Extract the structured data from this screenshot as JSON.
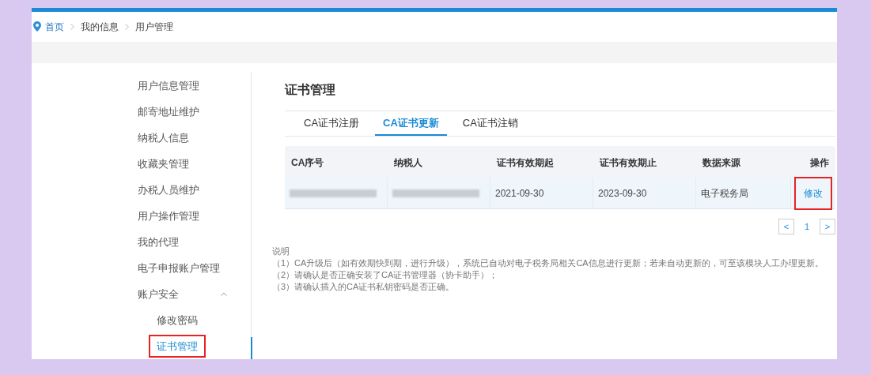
{
  "breadcrumb": [
    {
      "label": "首页",
      "kind": "home"
    },
    {
      "label": "我的信息",
      "kind": "plain"
    },
    {
      "label": "用户管理",
      "kind": "plain"
    }
  ],
  "sidebar": {
    "items": [
      {
        "label": "用户信息管理",
        "selected": false,
        "highlighted": false
      },
      {
        "label": "邮寄地址维护",
        "selected": false,
        "highlighted": false
      },
      {
        "label": "纳税人信息",
        "selected": false,
        "highlighted": false
      },
      {
        "label": "收藏夹管理",
        "selected": false,
        "highlighted": false
      },
      {
        "label": "办税人员维护",
        "selected": false,
        "highlighted": false
      },
      {
        "label": "用户操作管理",
        "selected": false,
        "highlighted": false
      },
      {
        "label": "我的代理",
        "selected": false,
        "highlighted": false
      },
      {
        "label": "电子申报账户管理",
        "selected": false,
        "highlighted": false
      },
      {
        "label": "账户安全",
        "selected": false,
        "highlighted": false,
        "expanded": true,
        "children": [
          {
            "label": "修改密码",
            "selected": false,
            "highlighted": false
          },
          {
            "label": "证书管理",
            "selected": true,
            "highlighted": true
          }
        ]
      }
    ]
  },
  "title": "证书管理",
  "tabs": [
    {
      "label": "CA证书注册",
      "selected": false
    },
    {
      "label": "CA证书更新",
      "selected": true
    },
    {
      "label": "CA证书注销",
      "selected": false
    }
  ],
  "table": {
    "columns": [
      "CA序号",
      "纳税人",
      "证书有效期起",
      "证书有效期止",
      "数据来源",
      "操作"
    ],
    "rows": [
      {
        "cells": [
          {
            "kind": "redacted"
          },
          {
            "kind": "redacted"
          },
          {
            "kind": "text",
            "text": "2021-09-30"
          },
          {
            "kind": "text",
            "text": "2023-09-30"
          },
          {
            "kind": "text",
            "text": "电子税务局"
          },
          {
            "kind": "link",
            "text": "修改",
            "highlighted": true
          }
        ]
      }
    ]
  },
  "pagination": {
    "prev": "<",
    "pages": [
      {
        "label": "1",
        "selected": true
      }
    ],
    "next": ">"
  },
  "notes": {
    "heading": "说明",
    "lines": [
      "（1）CA升级后（如有效期快到期，进行升级），系统已自动对电子税务局相关CA信息进行更新；若未自动更新的，可至该模块人工办理更新。",
      "（2）请确认是否正确安装了CA证书管理器（协卡助手）；",
      "（3）请确认插入的CA证书私钥密码是否正确。"
    ]
  }
}
